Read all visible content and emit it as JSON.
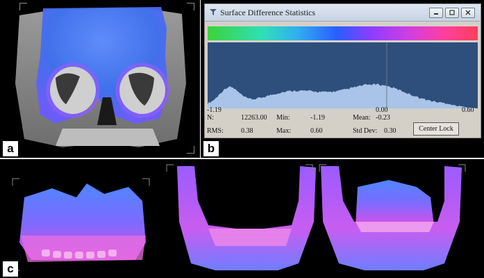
{
  "panel_a": {
    "letter": "a"
  },
  "panel_b": {
    "letter": "b",
    "window": {
      "title": "Surface Difference Statistics",
      "min_icon": "minimize-icon",
      "restore_icon": "restore-icon",
      "close_icon": "close-icon"
    },
    "colorbar": {
      "colors": [
        "#3bd33b",
        "#2fb0f0",
        "#2a5dff",
        "#8a3dff",
        "#d13fe0",
        "#ff3f5a"
      ]
    },
    "axis": {
      "left": "-1.19",
      "center": "0.00",
      "right": "0.60"
    },
    "stats": {
      "n_label": "N:",
      "n_value": "12263.00",
      "min_label": "Min:",
      "min_value": "-1.19",
      "mean_label": "Mean:",
      "mean_value": "-0.23",
      "rms_label": "RMS:",
      "rms_value": "0.38",
      "max_label": "Max:",
      "max_value": "0.60",
      "std_label": "Std Dev:",
      "std_value": "0.30"
    },
    "center_lock_label": "Center Lock"
  },
  "panel_c": {
    "letter": "c"
  }
}
